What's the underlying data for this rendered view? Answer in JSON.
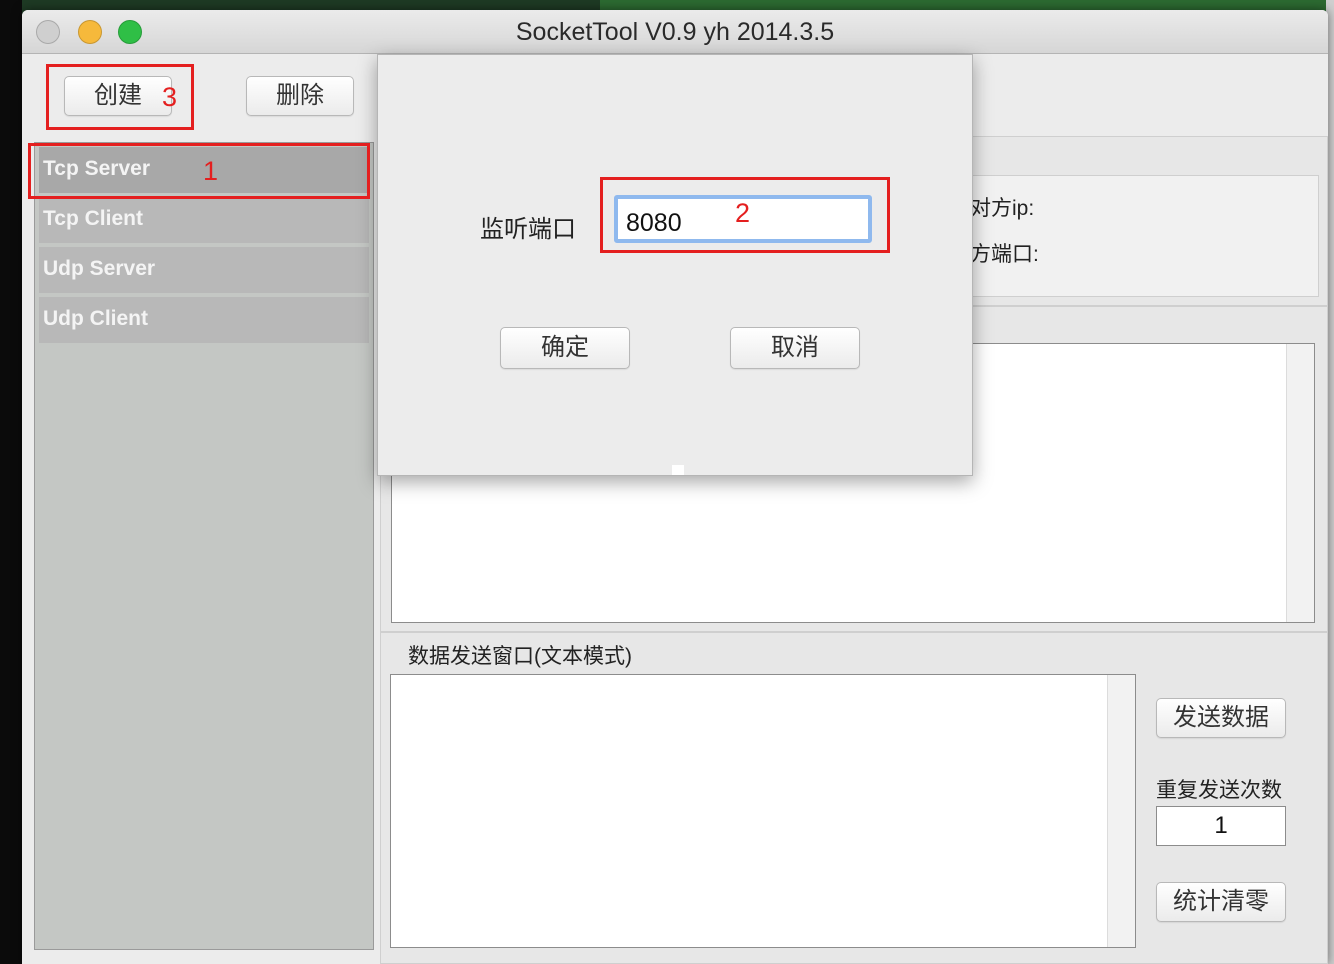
{
  "window": {
    "title": "SocketTool V0.9 yh 2014.3.5"
  },
  "toolbar": {
    "create_label": "创建",
    "delete_label": "删除"
  },
  "sidebar": {
    "items": [
      {
        "label": "Tcp Server"
      },
      {
        "label": "Tcp Client"
      },
      {
        "label": "Udp Server"
      },
      {
        "label": "Udp Client"
      }
    ]
  },
  "connection": {
    "peer_ip_label": "对方ip:",
    "peer_port_label": "方端口:"
  },
  "send": {
    "window_label": "数据发送窗口(文本模式)",
    "send_button": "发送数据",
    "repeat_label": "重复发送次数",
    "repeat_value": "1",
    "reset_button": "统计清零"
  },
  "dialog": {
    "port_label": "监听端口",
    "port_value": "8080",
    "ok_label": "确定",
    "cancel_label": "取消"
  },
  "annotations": {
    "n1": "1",
    "n2": "2",
    "n3": "3"
  },
  "colors": {
    "annotation": "#e41f1f",
    "focus_ring": "#8fb9ee",
    "selected_item": "#a8a8a8"
  }
}
